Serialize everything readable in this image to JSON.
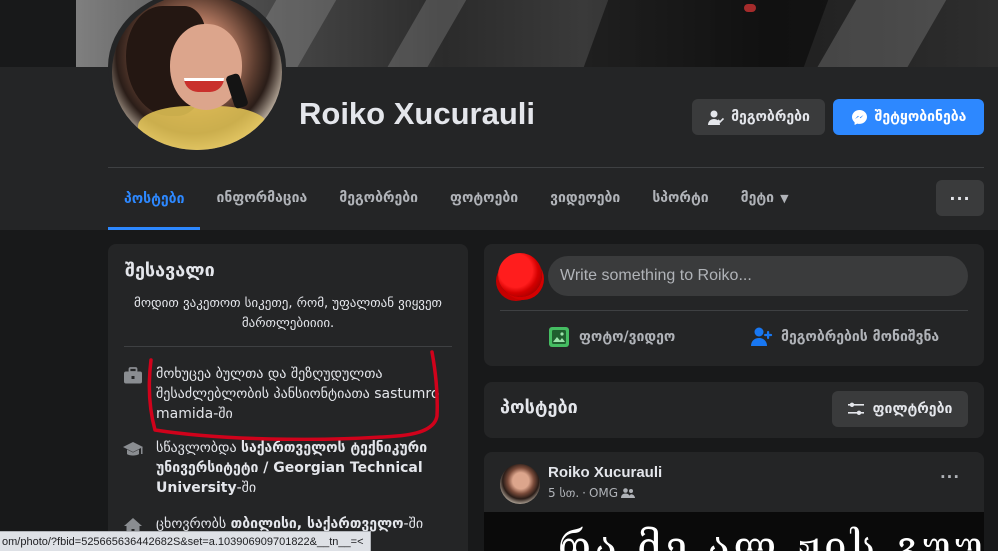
{
  "profile": {
    "name": "Roiko Xucurauli",
    "friends_button": "მეგობრები",
    "message_button": "შეტყობინება"
  },
  "tabs": [
    {
      "label": "პოსტები",
      "active": true
    },
    {
      "label": "ინფორმაცია"
    },
    {
      "label": "მეგობრები"
    },
    {
      "label": "ფოტოები"
    },
    {
      "label": "ვიდეოები"
    },
    {
      "label": "სპორტი"
    },
    {
      "label": "მეტი"
    }
  ],
  "more_button": "···",
  "intro": {
    "title": "შესავალი",
    "bio": "მოდით ვაკეთოთ სიკეთე, რომ, უფალთან ვიყვეთ მართლებიიიი.",
    "work": {
      "text": "მოხუცეა ბულთა და შეზღუდულთა შესაძლებლობის პანსიონტიათა sastumro mamida-ში"
    },
    "education": {
      "prefix": "სწავლობდა ",
      "school": "საქართველოს ტექნიკური უნივერსიტეტი / Georgian Technical University",
      "suffix": "-ში"
    },
    "home": {
      "prefix": "ცხოვრობს ",
      "city": "თბილისი, საქართველო",
      "suffix": "-ში"
    }
  },
  "composer": {
    "placeholder": "Write something to Roiko...",
    "photo_video": "ფოტო/ვიდეო",
    "tag_friends": "მეგობრების მონიშვნა"
  },
  "posts": {
    "title": "პოსტები",
    "filter_button": "ფილტრები",
    "first": {
      "author": "Roiko Xucurauli",
      "time": "5 სთ.",
      "separator": "·",
      "location": "OMG",
      "audience_icon": "friends-icon",
      "media_text": "რა მე ალ ჟის გუურს"
    }
  },
  "status_bar": {
    "url": "om/photo/?fbid=525665636442682S&set=a.103906909701822&__tn__=<"
  },
  "colors": {
    "page_bg": "#18191a",
    "card_bg": "#242526",
    "accent": "#2d88ff",
    "text_primary": "#e4e6eb",
    "text_secondary": "#b0b3b8",
    "annotation_red": "#d0021b"
  }
}
